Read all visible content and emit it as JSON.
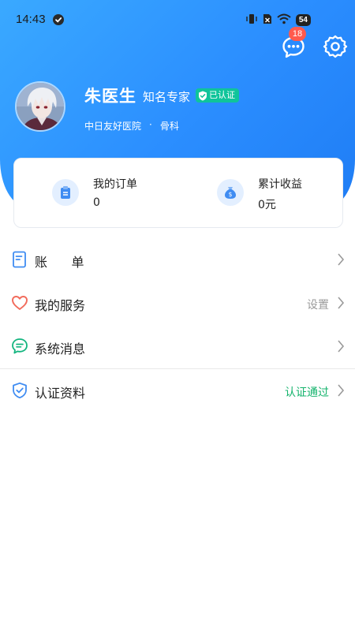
{
  "status_bar": {
    "time": "14:43",
    "battery": "54"
  },
  "header": {
    "message_badge": "18",
    "doctor_name": "朱医生",
    "doctor_title": "知名专家",
    "verified_label": "已认证",
    "hospital": "中日友好医院",
    "separator": "·",
    "department": "骨科"
  },
  "stats": [
    {
      "label": "我的订单",
      "value": "0",
      "icon": "clipboard-icon"
    },
    {
      "label": "累计收益",
      "value": "0元",
      "icon": "money-bag-icon"
    }
  ],
  "menu": [
    {
      "label": "账      单",
      "value": "",
      "icon": "bill-icon"
    },
    {
      "label": "我的服务",
      "value": "设置",
      "icon": "heart-icon"
    },
    {
      "label": "系统消息",
      "value": "",
      "icon": "chat-icon"
    },
    {
      "label": "认证资料",
      "value": "认证通过",
      "icon": "shield-check-icon"
    }
  ],
  "colors": {
    "primary": "#2b8eff",
    "badge": "#ff5a4d",
    "verified": "#0fc49a",
    "success_text": "#14b36c"
  }
}
